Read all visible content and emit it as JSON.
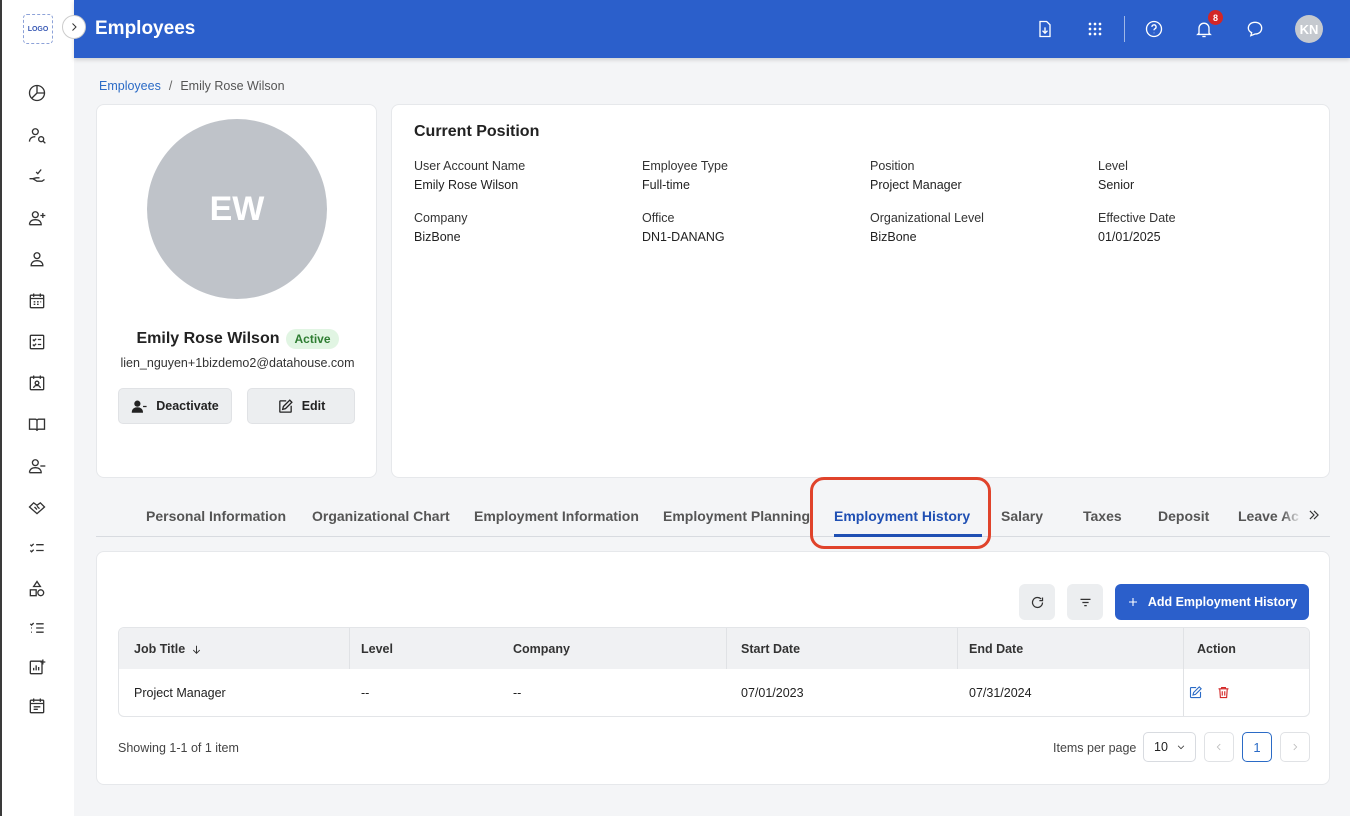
{
  "logo": {
    "text": "LOGO"
  },
  "header": {
    "title": "Employees",
    "notification_count": "8",
    "user_initials": "KN"
  },
  "breadcrumb": {
    "root": "Employees",
    "separator": "/",
    "current": "Emily Rose Wilson"
  },
  "profile": {
    "initials": "EW",
    "name": "Emily Rose Wilson",
    "status": "Active",
    "email": "lien_nguyen+1bizdemo2@datahouse.com",
    "deactivate_label": "Deactivate",
    "edit_label": "Edit"
  },
  "current_position": {
    "title": "Current Position",
    "fields": [
      {
        "label": "User Account Name",
        "value": "Emily Rose Wilson"
      },
      {
        "label": "Employee Type",
        "value": "Full-time"
      },
      {
        "label": "Position",
        "value": "Project Manager"
      },
      {
        "label": "Level",
        "value": "Senior"
      },
      {
        "label": "Company",
        "value": "BizBone"
      },
      {
        "label": "Office",
        "value": "DN1-DANANG"
      },
      {
        "label": "Organizational Level",
        "value": "BizBone"
      },
      {
        "label": "Effective Date",
        "value": "01/01/2025"
      }
    ]
  },
  "tabs": [
    {
      "label": "Personal Information"
    },
    {
      "label": "Organizational Chart"
    },
    {
      "label": "Employment Information"
    },
    {
      "label": "Employment Planning"
    },
    {
      "label": "Employment History"
    },
    {
      "label": "Salary"
    },
    {
      "label": "Taxes"
    },
    {
      "label": "Deposit"
    },
    {
      "label": "Leave Ac"
    }
  ],
  "active_tab": "Employment History",
  "table": {
    "add_button_label": "Add Employment History",
    "columns": [
      "Job Title",
      "Level",
      "Company",
      "Start Date",
      "End Date",
      "Action"
    ],
    "rows": [
      {
        "job_title": "Project Manager",
        "level": "--",
        "company": "--",
        "start_date": "07/01/2023",
        "end_date": "07/31/2024"
      }
    ]
  },
  "pagination": {
    "summary": "Showing 1-1 of 1 item",
    "items_per_page_label": "Items per page",
    "items_per_page": "10",
    "current_page": "1"
  },
  "colors": {
    "primary": "#2b5fcb",
    "active_tab": "#1f4fb3",
    "highlight": "#e0432b",
    "badge": "#d32626",
    "delete": "#d32626"
  }
}
